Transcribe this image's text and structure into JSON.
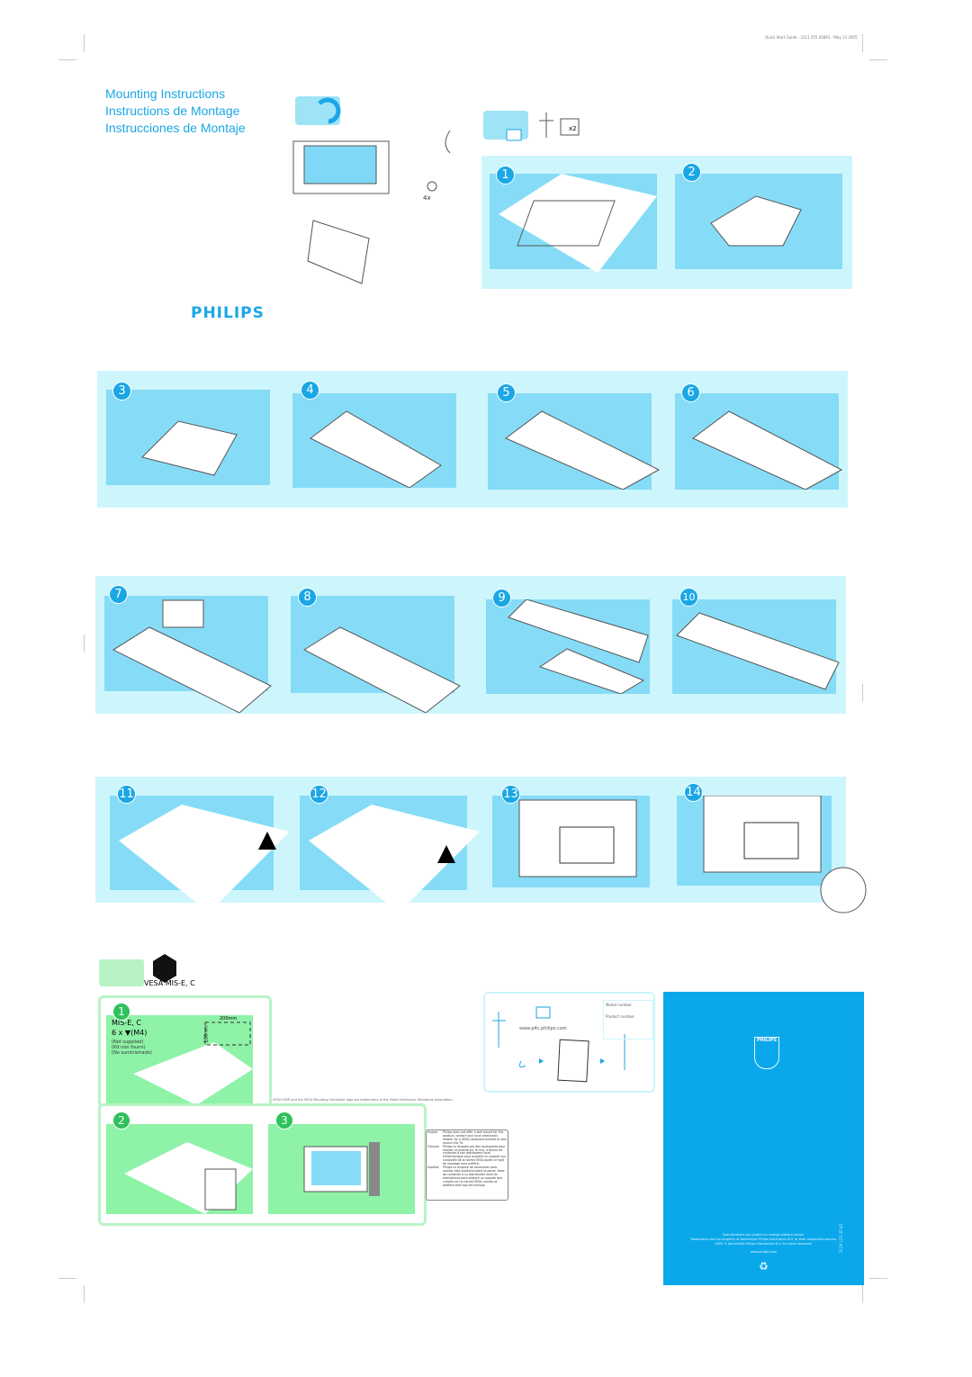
{
  "header": {
    "doc_ref": "Quick Start Guide - 3111 255 65891 - May 13 2005"
  },
  "title": {
    "lines": [
      "Mounting Instructions",
      "Instructions de Montage",
      "Instrucciones de Montaje"
    ]
  },
  "brand": {
    "logo": "PHILIPS"
  },
  "parts": {
    "screws_count": "4x",
    "bracket_count": "x2"
  },
  "steps": [
    "1",
    "2",
    "3",
    "4",
    "5",
    "6",
    "7",
    "8",
    "9",
    "10",
    "11",
    "12",
    "13",
    "14"
  ],
  "vesa": {
    "label": "VESA MIS-E, C",
    "steps": [
      "1",
      "2",
      "3"
    ],
    "spec_title": "MIS-E, C",
    "screws": "6 x",
    "screw_size": "(M4)",
    "not_supplied": [
      "(Not supplied)",
      "(Kit non fourni)",
      "(No suministrado)"
    ],
    "dim_h": "200mm",
    "dim_v": "100mm",
    "trademark": "VESA FDMI and the VESA Mounting Compliant logo are trademarks of the Video Electronics Standards Association."
  },
  "languages": [
    {
      "lang": "English",
      "text": "Philips does not offer a wall mount for this product, contact your local electronics retailer for a VESA compliant bracket to wall mount this TV."
    },
    {
      "lang": "Français",
      "text": "Philips ne dispose pas des accessoires pour monter ce produit sur le mur, à faveur de contacter à son distributeur local d'électronique pour acquérir un support qui s'acquitte de la norme VESA quant ce type de montage sera préféré."
    },
    {
      "lang": "Español",
      "text": "Philips no dispone de accesorios para montar este producto sobre la pared, favor de contactar a su distribuidor local de electrónicos para adquirir un soporte que cumpla con la norma VESA cuando se prefiera este tipo de montaje."
    }
  ],
  "support": {
    "url": "www.p4c.philips.com",
    "model_number": "Model number",
    "product_number": "Product number"
  },
  "back": {
    "logo": "PHILIPS",
    "notice": [
      "Specifications are subject to change without notice.",
      "Trademarks are the property of Koninklijke Philips Electronics N.V. or their respective owners.",
      "2005 © Koninklijke Philips Electronics N.V. All rights reserved."
    ],
    "url": "www.philips.com",
    "code": "3139 125 35341"
  },
  "colors": {
    "accent": "#1aa7e6",
    "panel": "#ccf6fc",
    "box": "#86dcf6",
    "green": "#8ef2a7",
    "back": "#0aa8ea"
  }
}
